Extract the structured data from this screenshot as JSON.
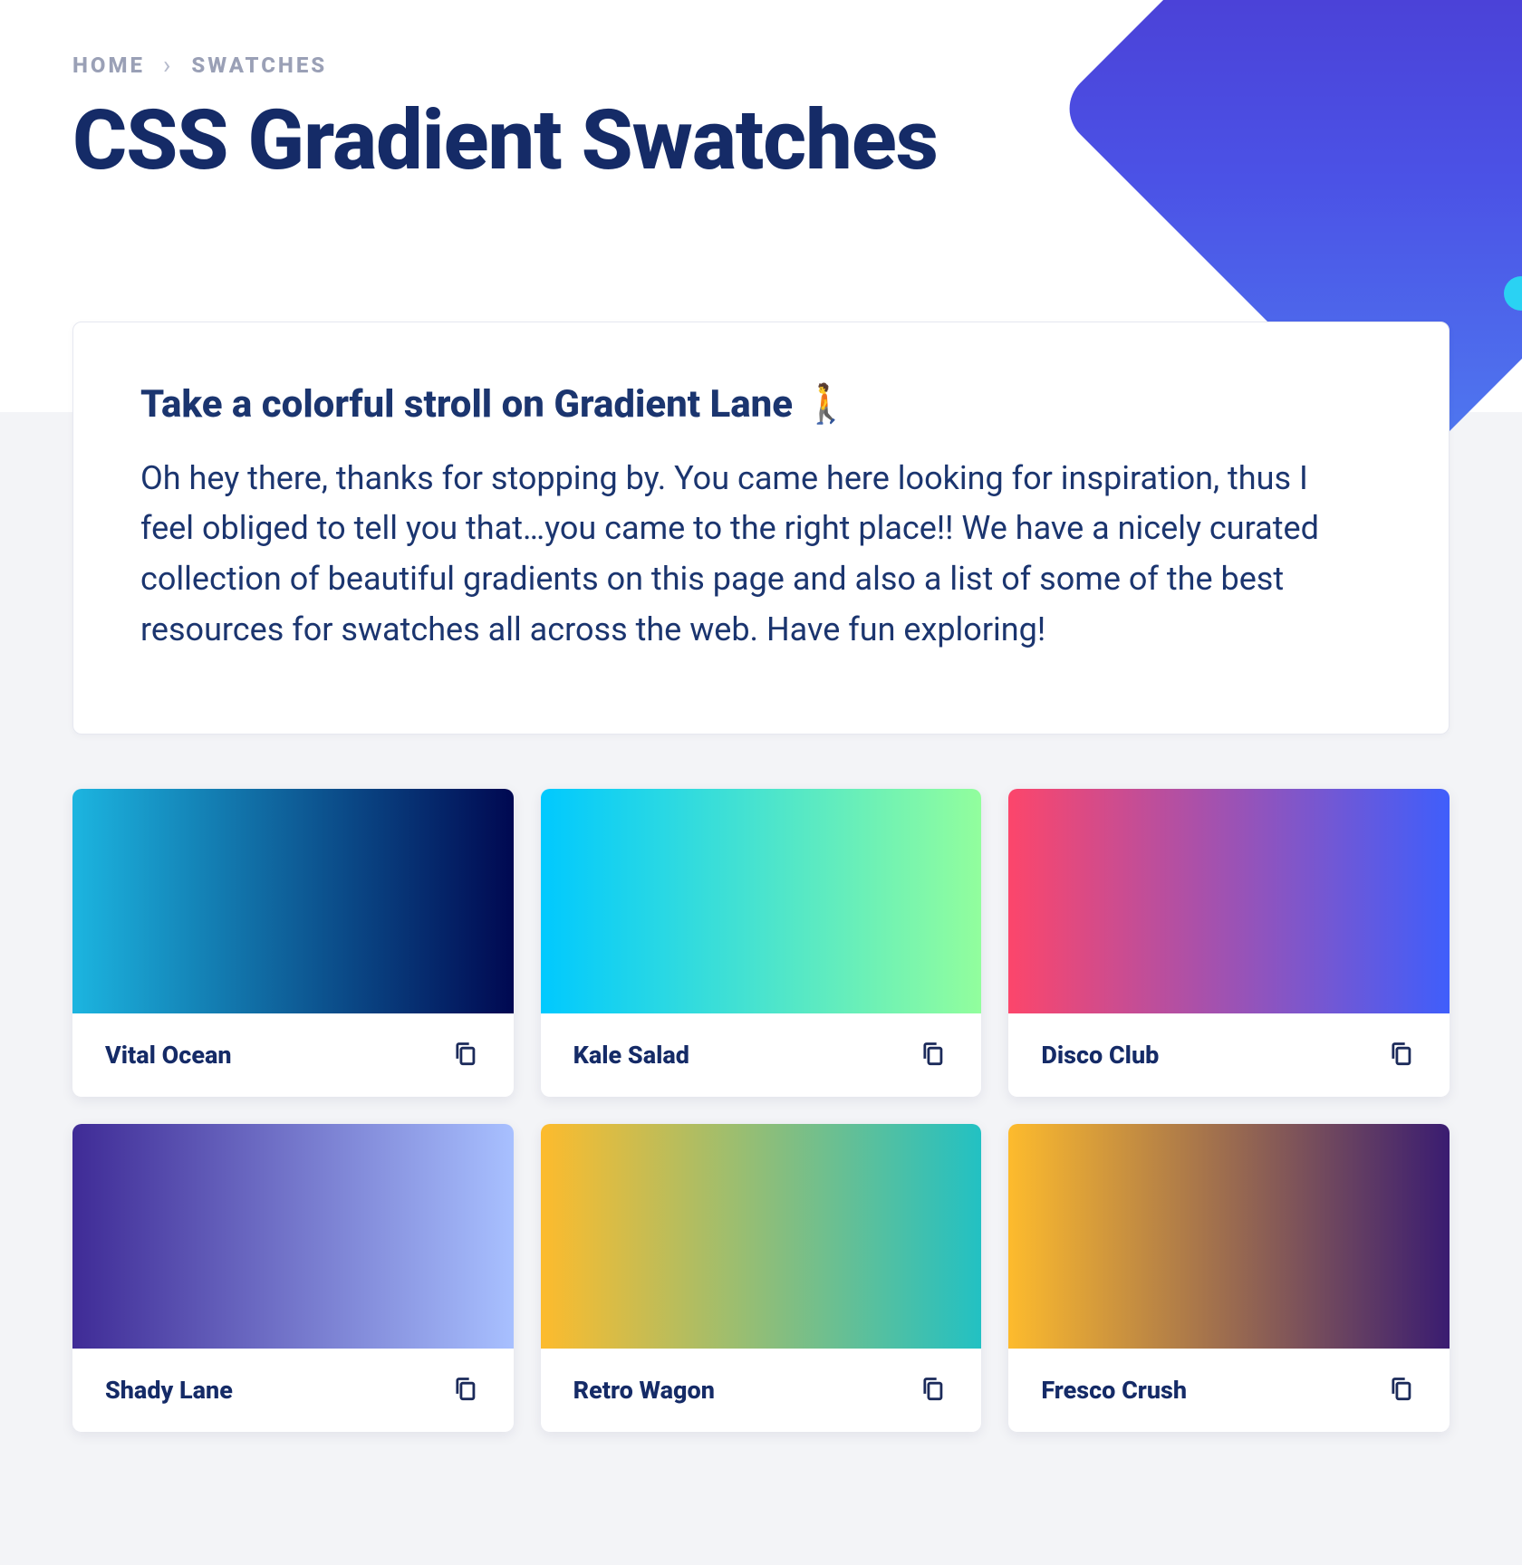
{
  "breadcrumb": {
    "home": "Home",
    "separator": "›",
    "current": "Swatches"
  },
  "page_title": "CSS Gradient Swatches",
  "intro": {
    "heading": "Take a colorful stroll on Gradient Lane 🚶",
    "body": "Oh hey there, thanks for stopping by. You came here looking for inspiration, thus I feel obliged to tell you that…you came to the right place!! We have a nicely curated collection of beautiful gradients on this page and also a list of some of the best resources for swatches all across the web. Have fun exploring!"
  },
  "swatches": [
    {
      "name": "Vital Ocean",
      "gradient": "linear-gradient(90deg, #1cb5e0 0%, #000851 100%)"
    },
    {
      "name": "Kale Salad",
      "gradient": "linear-gradient(90deg, #00c9ff 0%, #92fe9d 100%)"
    },
    {
      "name": "Disco Club",
      "gradient": "linear-gradient(90deg, #fc466b 0%, #3f5efb 100%)"
    },
    {
      "name": "Shady Lane",
      "gradient": "linear-gradient(90deg, #3f2b96 0%, #a8c0ff 100%)"
    },
    {
      "name": "Retro Wagon",
      "gradient": "linear-gradient(90deg, #fdbb2d 0%, #22c1c3 100%)"
    },
    {
      "name": "Fresco Crush",
      "gradient": "linear-gradient(90deg, #fdbb2d 0%, #3a1c71 100%)"
    }
  ],
  "icons": {
    "copy": "copy-icon"
  }
}
